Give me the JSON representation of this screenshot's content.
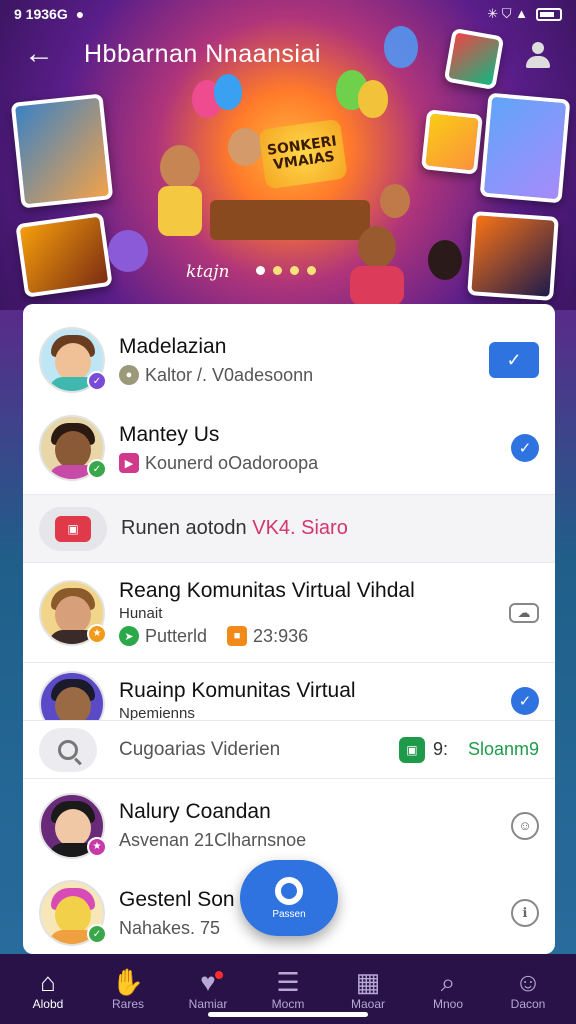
{
  "status_bar": {
    "time": "9 1936G",
    "right_text": "✳ ⛉ ▲"
  },
  "header": {
    "title": "Hbbarnan Nnaansiai"
  },
  "hero": {
    "sign_text": "SONKERI VMAIAS",
    "caption": "ktajn",
    "dots": 4,
    "active_dot": 0
  },
  "list": {
    "rows": [
      {
        "title": "Madelazian",
        "subtitle": "Kaltor /. V0adesoonn",
        "action": "check-square"
      },
      {
        "title": "Mantey Us",
        "subtitle": "Kounerd oOadoroopa",
        "action": "check-circle"
      },
      {
        "title": "Reang Komunitas Virtual Vihdal",
        "subtitle2": "Hunait",
        "subtitle": "Putterld",
        "tag": "23:936",
        "action": "outline"
      },
      {
        "title": "Ruainp Komunitas Virtual",
        "subtitle2": "Npemienns",
        "action": "check-circle"
      },
      {
        "title": "Nalury Coandan",
        "subtitle": "Asvenan 21Clharnsnoe",
        "action": "outline"
      },
      {
        "title": "Gestenl Son",
        "subtitle": "Nahakes. 75",
        "action": "outline"
      }
    ],
    "filter_text": "Runen aotodn ",
    "filter_accent": "VK4. Siaro",
    "search_placeholder": "Cugoarias Viderien",
    "search_count": "9:",
    "search_green": "Sloanm9"
  },
  "fab": {
    "label": "Passen"
  },
  "nav": {
    "items": [
      {
        "label": "Alobd",
        "glyph": "⌂"
      },
      {
        "label": "Rares",
        "glyph": "✋"
      },
      {
        "label": "Namiar",
        "glyph": "♥"
      },
      {
        "label": "Mocm",
        "glyph": "☰"
      },
      {
        "label": "Maoar",
        "glyph": "▦"
      },
      {
        "label": "Mnoo",
        "glyph": "⌕"
      },
      {
        "label": "Dacon",
        "glyph": "☺"
      }
    ]
  },
  "colors": {
    "accent": "#2f73e0",
    "nav_bg": "#281247",
    "green": "#1e9a4a",
    "pink": "#d2366a"
  }
}
